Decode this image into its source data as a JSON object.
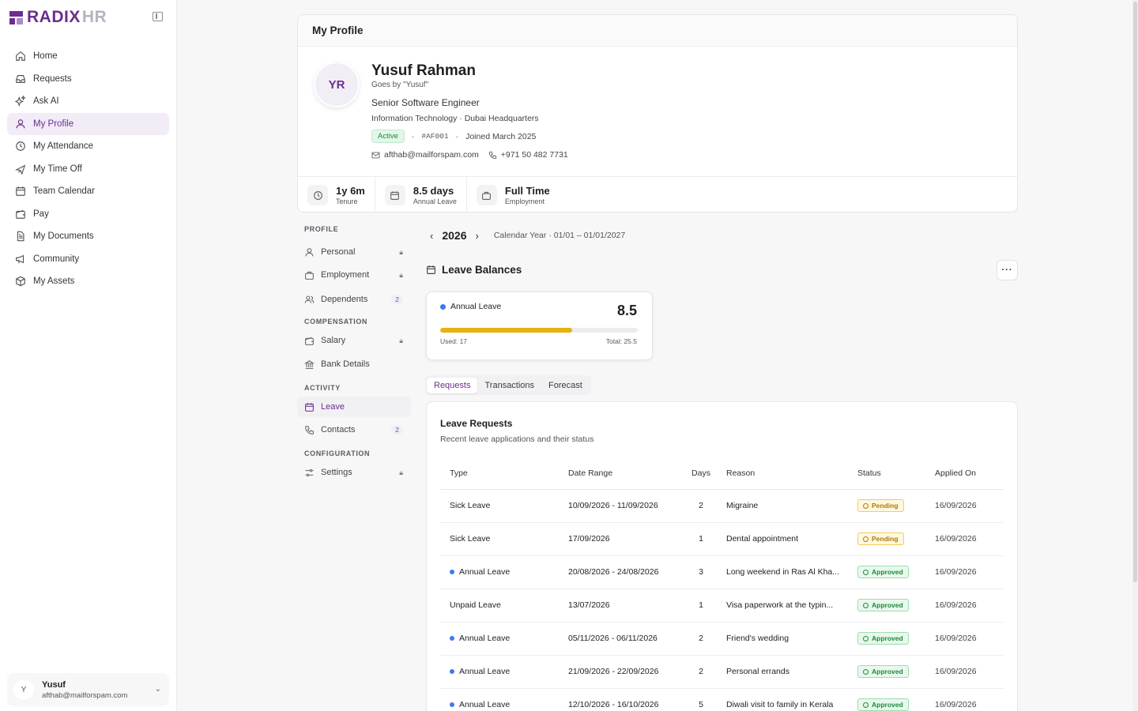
{
  "brand": {
    "part1": "RADIX",
    "part2": "HR"
  },
  "nav": [
    {
      "label": "Home",
      "icon": "home-icon"
    },
    {
      "label": "Requests",
      "icon": "inbox-icon"
    },
    {
      "label": "Ask AI",
      "icon": "sparkles-icon"
    },
    {
      "label": "My Profile",
      "icon": "user-icon",
      "active": true
    },
    {
      "label": "My Attendance",
      "icon": "clock-icon"
    },
    {
      "label": "My Time Off",
      "icon": "plane-icon"
    },
    {
      "label": "Team Calendar",
      "icon": "calendar-icon"
    },
    {
      "label": "Pay",
      "icon": "wallet-icon"
    },
    {
      "label": "My Documents",
      "icon": "document-icon"
    },
    {
      "label": "Community",
      "icon": "megaphone-icon"
    },
    {
      "label": "My Assets",
      "icon": "box-icon"
    }
  ],
  "user": {
    "initial": "Y",
    "name": "Yusuf",
    "email": "afthab@mailforspam.com"
  },
  "profile": {
    "header": "My Profile",
    "initials": "YR",
    "name": "Yusuf Rahman",
    "goes_by": "Goes by \"Yusuf\"",
    "title": "Senior Software Engineer",
    "dept": "Information Technology · Dubai Headquarters",
    "status": "Active",
    "emp_id": "#AF001",
    "joined": "Joined March 2025",
    "email": "afthab@mailforspam.com",
    "phone": "+971 50 482 7731",
    "sep": "·"
  },
  "stats": [
    {
      "value": "1y 6m",
      "label": "Tenure",
      "icon": "clock-icon"
    },
    {
      "value": "8.5 days",
      "label": "Annual Leave",
      "icon": "calendar-icon"
    },
    {
      "value": "Full Time",
      "label": "Employment",
      "icon": "briefcase-icon"
    }
  ],
  "subnav": {
    "profile_head": "PROFILE",
    "personal": "Personal",
    "employment": "Employment",
    "dependents": "Dependents",
    "dependents_count": "2",
    "comp_head": "COMPENSATION",
    "salary": "Salary",
    "bank": "Bank Details",
    "activity_head": "ACTIVITY",
    "leave": "Leave",
    "contacts": "Contacts",
    "contacts_count": "2",
    "config_head": "CONFIGURATION",
    "settings": "Settings"
  },
  "year": {
    "value": "2026",
    "note": "Calendar Year · 01/01 – 01/01/2027"
  },
  "leave_balances": {
    "title": "Leave Balances",
    "more": "···",
    "card": {
      "name": "Annual Leave",
      "remaining": "8.5",
      "used_label": "Used: 17",
      "total_label": "Total: 25.5",
      "used_fraction": 0.667,
      "bar_color": "#e9b00e"
    }
  },
  "tabs": [
    "Requests",
    "Transactions",
    "Forecast"
  ],
  "requests": {
    "title": "Leave Requests",
    "subtitle": "Recent leave applications and their status",
    "columns": [
      "Type",
      "Date Range",
      "Days",
      "Reason",
      "Status",
      "Applied On"
    ],
    "rows": [
      {
        "type": "Sick Leave",
        "dot": false,
        "range": "10/09/2026 - 11/09/2026",
        "days": "2",
        "reason": "Migraine",
        "status": "Pending",
        "applied": "16/09/2026"
      },
      {
        "type": "Sick Leave",
        "dot": false,
        "range": "17/09/2026",
        "days": "1",
        "reason": "Dental appointment",
        "status": "Pending",
        "applied": "16/09/2026"
      },
      {
        "type": "Annual Leave",
        "dot": true,
        "range": "20/08/2026 - 24/08/2026",
        "days": "3",
        "reason": "Long weekend in Ras Al Kha...",
        "status": "Approved",
        "applied": "16/09/2026"
      },
      {
        "type": "Unpaid Leave",
        "dot": false,
        "range": "13/07/2026",
        "days": "1",
        "reason": "Visa paperwork at the typin...",
        "status": "Approved",
        "applied": "16/09/2026"
      },
      {
        "type": "Annual Leave",
        "dot": true,
        "range": "05/11/2026 - 06/11/2026",
        "days": "2",
        "reason": "Friend's wedding",
        "status": "Approved",
        "applied": "16/09/2026"
      },
      {
        "type": "Annual Leave",
        "dot": true,
        "range": "21/09/2026 - 22/09/2026",
        "days": "2",
        "reason": "Personal errands",
        "status": "Approved",
        "applied": "16/09/2026"
      },
      {
        "type": "Annual Leave",
        "dot": true,
        "range": "12/10/2026 - 16/10/2026",
        "days": "5",
        "reason": "Diwali visit to family in Kerala",
        "status": "Approved",
        "applied": "16/09/2026"
      }
    ]
  }
}
